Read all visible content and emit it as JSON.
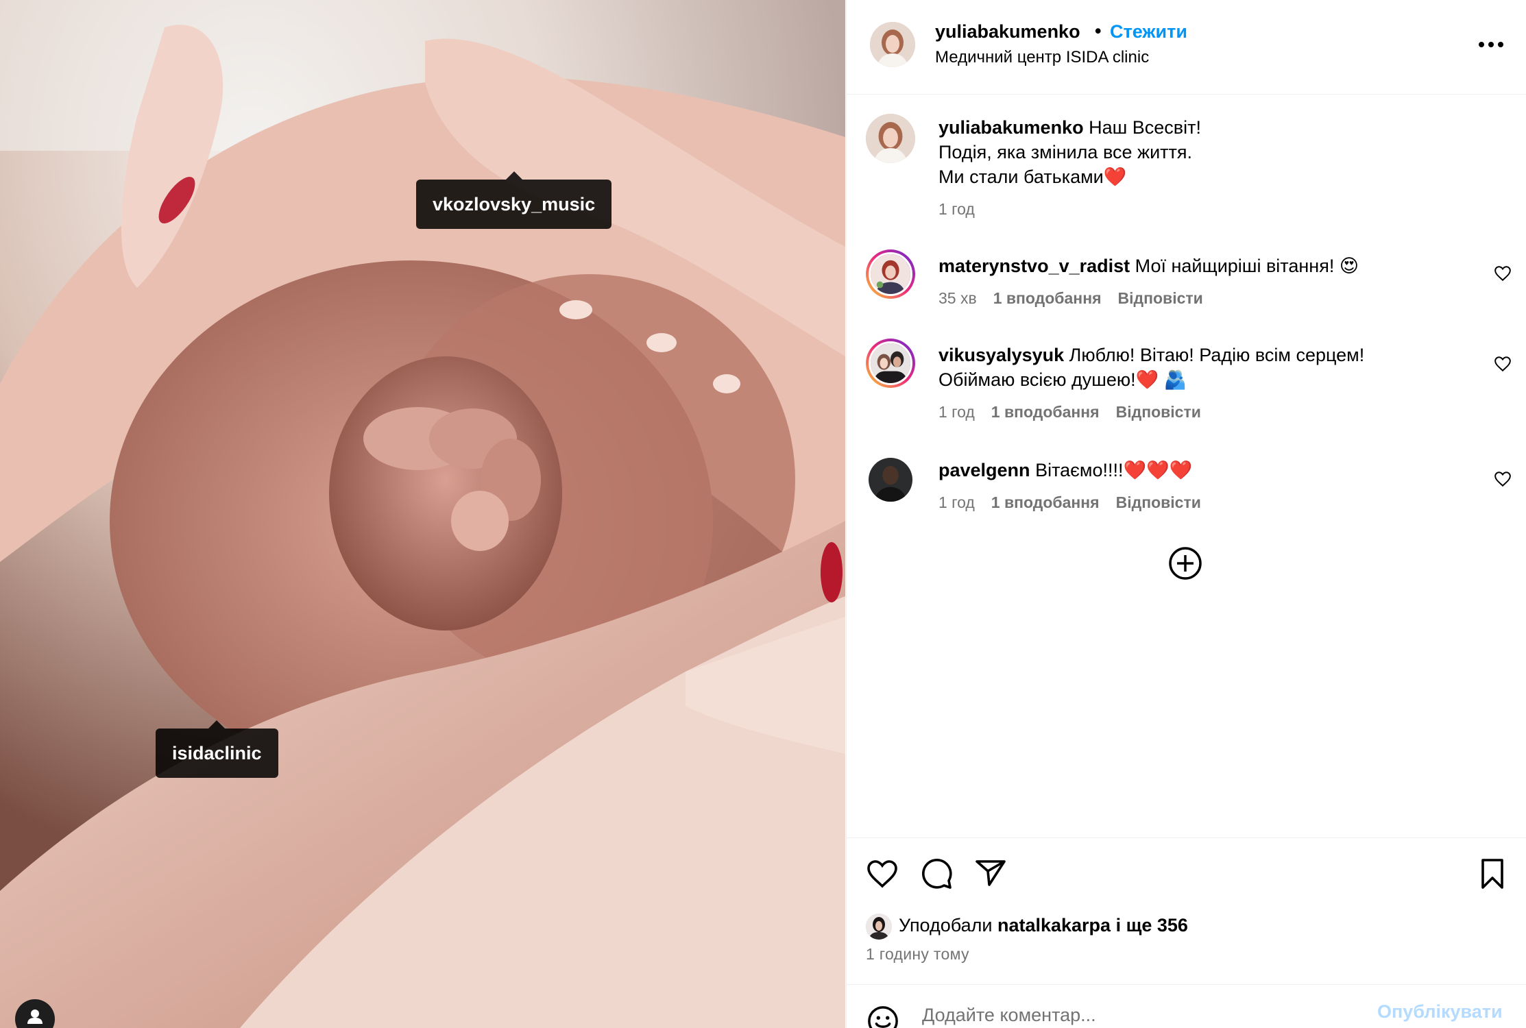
{
  "post": {
    "author": "yuliabakumenko",
    "follow_label": "Стежити",
    "separator": "•",
    "location": "Медичний центр ISIDA clinic"
  },
  "media": {
    "tags": [
      "vkozlovsky_music",
      "isidaclinic"
    ]
  },
  "caption": {
    "user": "yuliabakumenko",
    "line1": "Наш Всесвіт!",
    "line2": "Подія, яка змінила все життя.",
    "line3": "Ми стали батьками",
    "line3_emoji": "❤️",
    "time": "1 год"
  },
  "comments": [
    {
      "user": "materynstvo_v_radist",
      "text": "Мої найщиріші вітання! 😍",
      "time": "35 хв",
      "likes": "1 вподобання",
      "reply": "Відповісти"
    },
    {
      "user": "vikusyalysyuk",
      "text": "Люблю! Вітаю! Радію всім серцем!",
      "text2": "Обіймаю всією душею!❤️ 🫂",
      "time": "1 год",
      "likes": "1 вподобання",
      "reply": "Відповісти"
    },
    {
      "user": "pavelgenn",
      "text": "Вітаємо!!!!❤️❤️❤️",
      "time": "1 год",
      "likes": "1 вподобання",
      "reply": "Відповісти"
    }
  ],
  "likes": {
    "prefix": "Уподобали ",
    "user": "natalkakarpa",
    "suffix": " і ще 356",
    "time_ago": "1 годину тому"
  },
  "composer": {
    "placeholder": "Додайте коментар...",
    "publish_label": "Опублікувати"
  },
  "icons": {
    "more": "more-horizontal-icon",
    "like": "heart-outline-icon",
    "comment": "comment-bubble-icon",
    "share": "paper-plane-icon",
    "save": "bookmark-icon",
    "add": "plus-circle-icon",
    "emoji": "smiley-icon",
    "user_tags": "person-icon"
  },
  "colors": {
    "accent": "#0095f6",
    "muted": "#737373",
    "publish_disabled": "#b3dbff"
  }
}
